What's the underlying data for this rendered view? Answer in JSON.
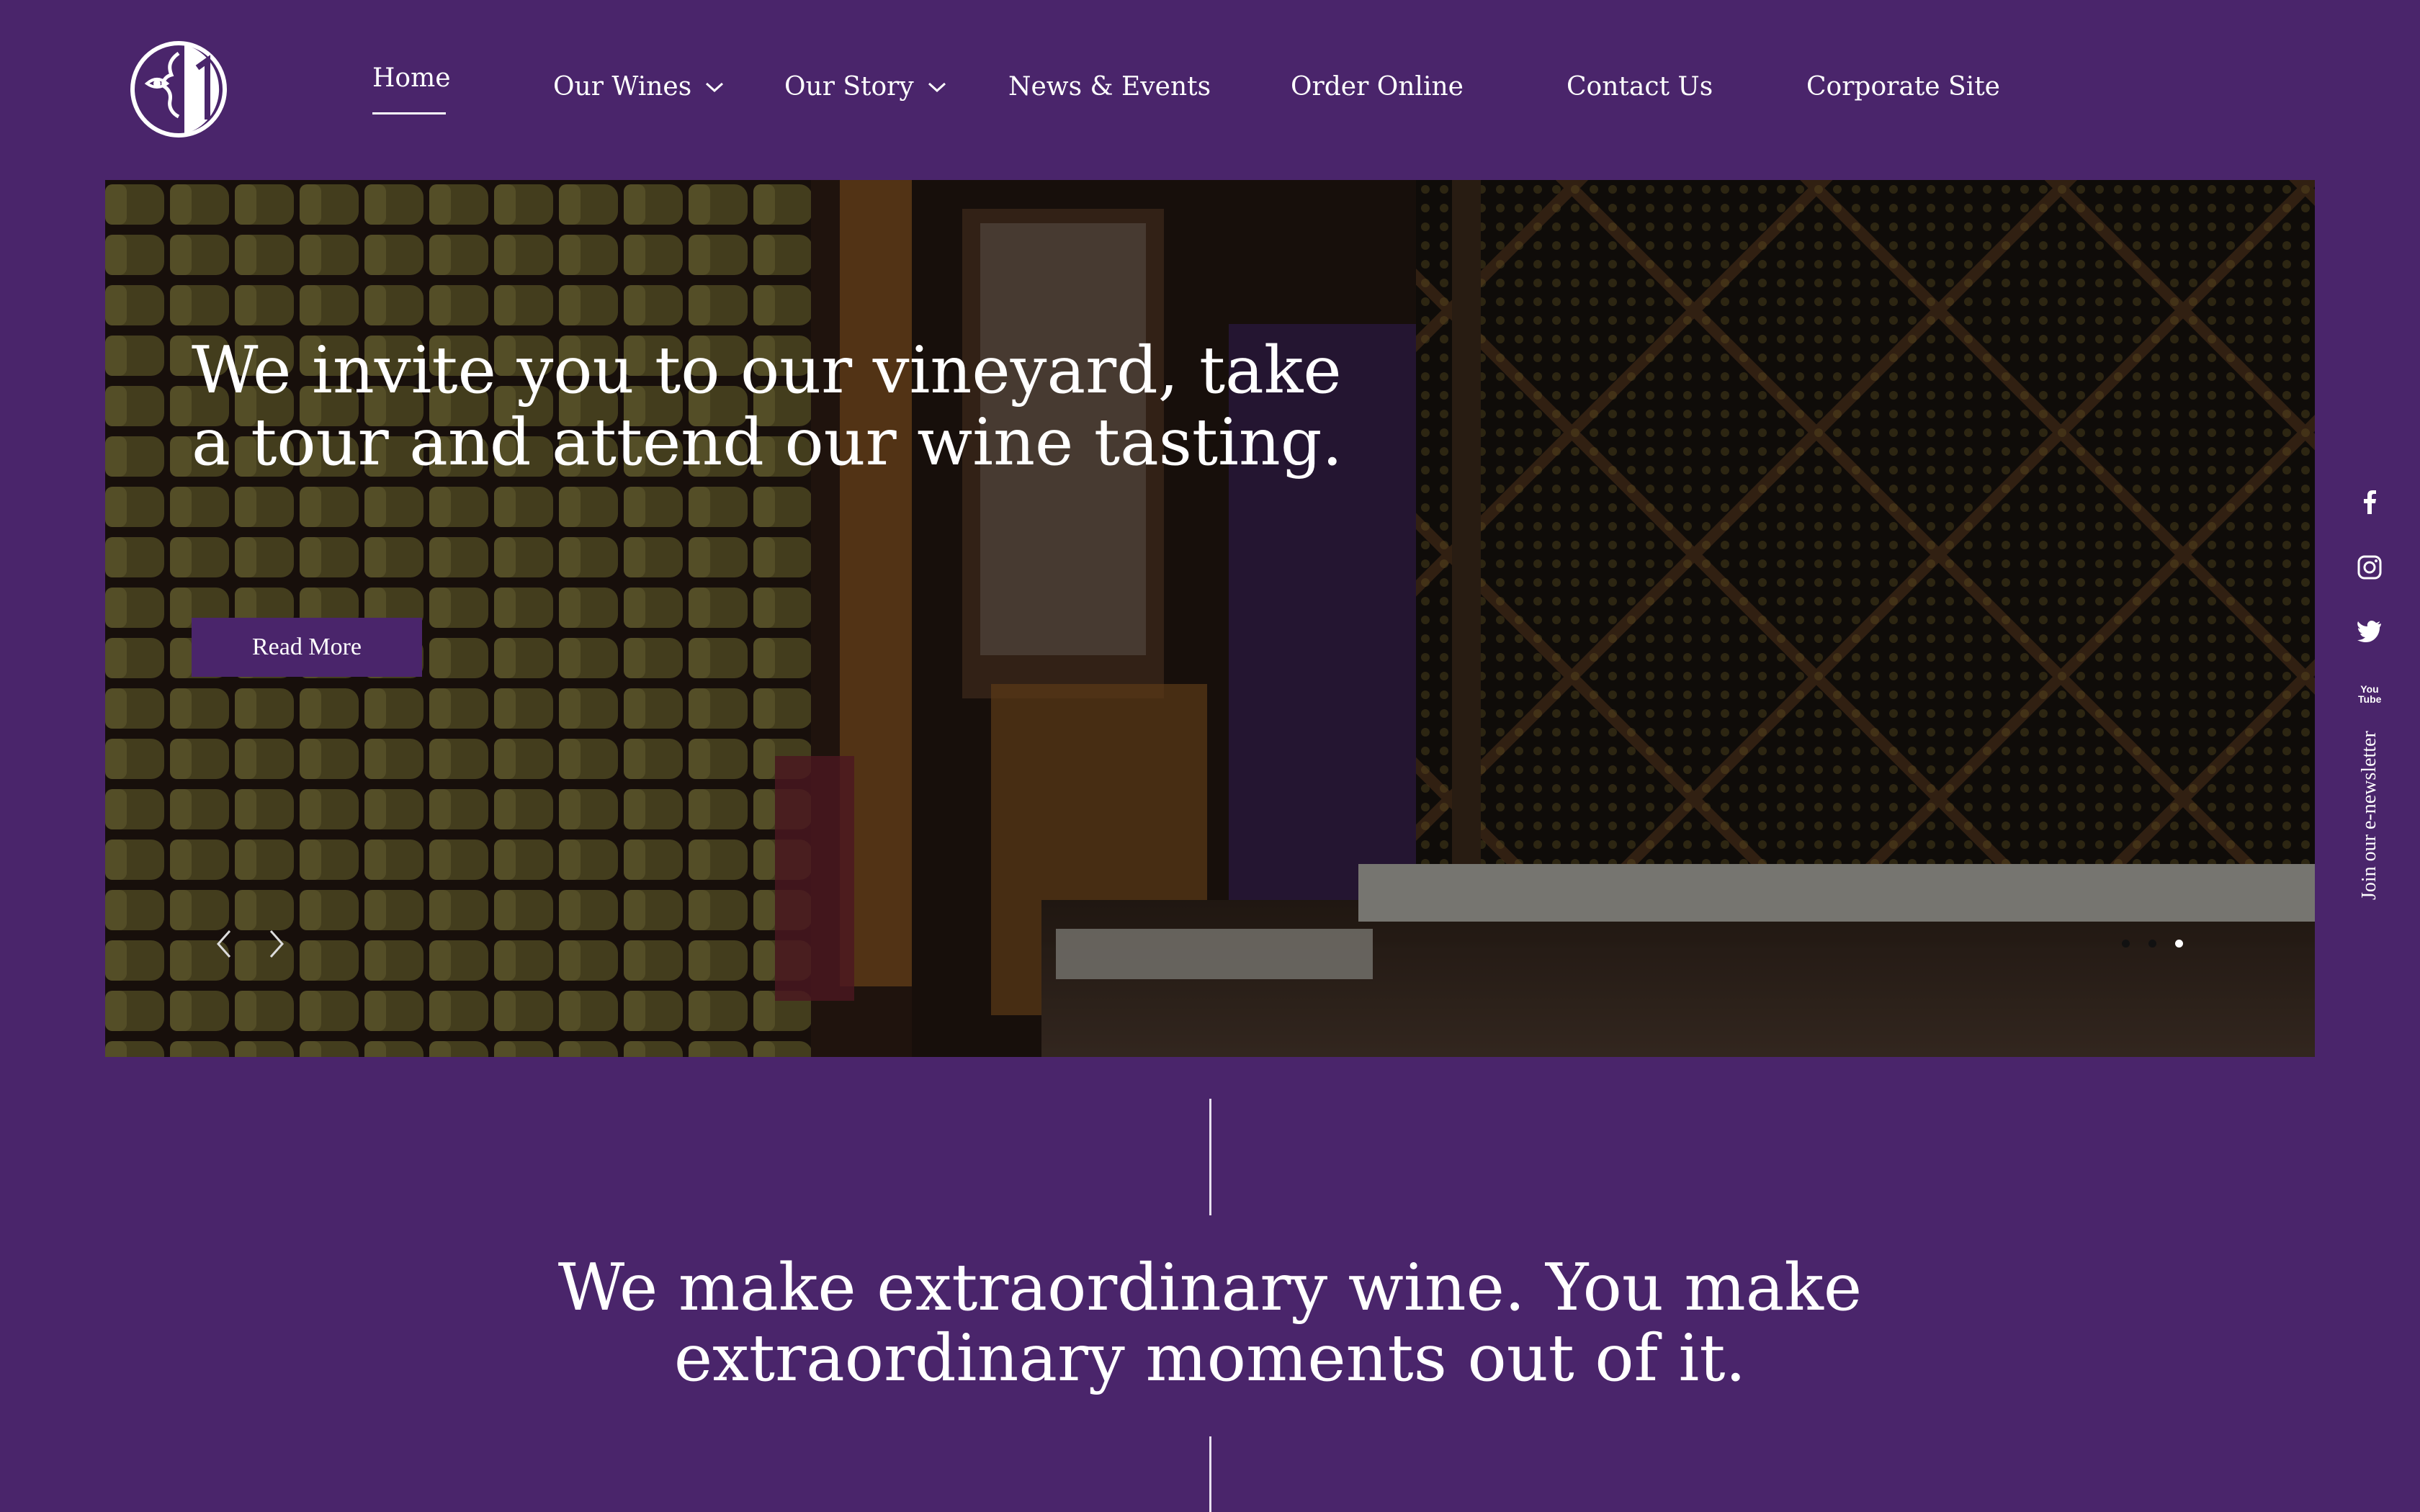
{
  "brand": {
    "logo_icon": "face-profile-logo"
  },
  "nav": {
    "items": [
      {
        "label": "Home",
        "active": true
      },
      {
        "label": "Our Wines",
        "dropdown": true
      },
      {
        "label": "Our Story",
        "dropdown": true
      },
      {
        "label": "News & Events"
      },
      {
        "label": "Order Online"
      },
      {
        "label": "Contact Us"
      },
      {
        "label": "Corporate Site"
      }
    ]
  },
  "hero": {
    "title": "We invite you to our vineyard, take a tour and attend our wine tasting.",
    "cta_label": "Read More",
    "slides_count": 3,
    "active_slide": 3
  },
  "social": {
    "icons": [
      "facebook-icon",
      "instagram-icon",
      "twitter-icon",
      "youtube-icon"
    ],
    "youtube_text": "You Tube",
    "newsletter_label": "Join our e-newsletter"
  },
  "intro": {
    "tagline": "We make extraordinary wine. You make extraordinary moments out of it."
  },
  "colors": {
    "background": "#4a256b",
    "text": "#ffffff",
    "button": "#4a256b"
  }
}
